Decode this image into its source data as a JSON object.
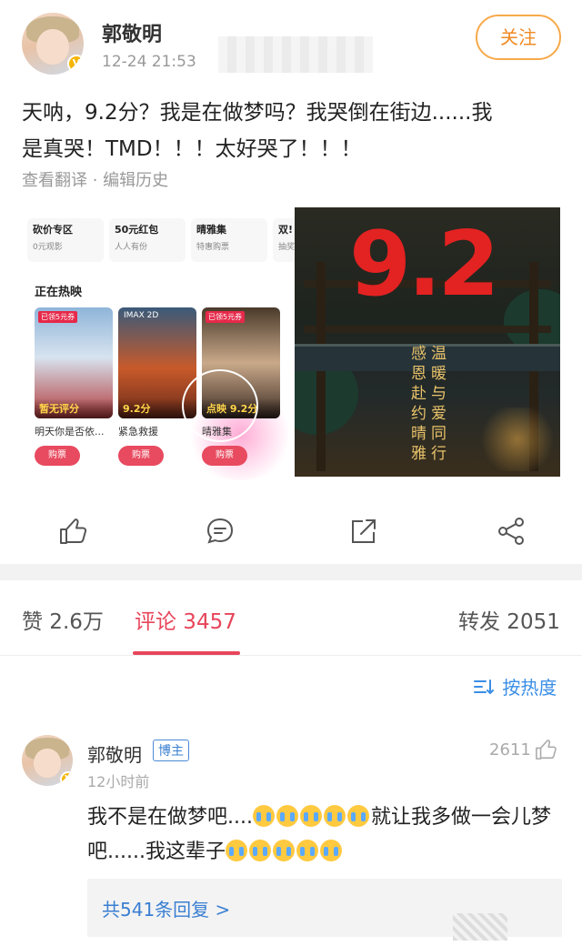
{
  "post": {
    "author": "郭敬明",
    "time": "12-24 21:53",
    "follow_label": "关注",
    "text_line1": "天呐，9.2分？我是在做梦吗？我哭倒在街边......我",
    "text_line2": "是真哭！TMD！！！太好哭了！！！",
    "meta": "查看翻译 · 编辑历史"
  },
  "embedded": {
    "promos": [
      {
        "title": "砍价专区",
        "sub": "0元观影"
      },
      {
        "title": "50元红包",
        "sub": "人人有份"
      },
      {
        "title": "晴雅集",
        "sub": "特惠购票"
      },
      {
        "title": "双!",
        "sub": "抽奖"
      }
    ],
    "section": "正在热映",
    "movies": [
      {
        "tag": "已领5元券",
        "label": "暂无评分",
        "name": "明天你是否依...",
        "buy": "购票"
      },
      {
        "tag": "IMAX 2D",
        "label": "9.2分",
        "name": "紧急救援",
        "buy": "购票"
      },
      {
        "tag": "已领5元券",
        "label": "点映 9.2分",
        "name": "晴雅集",
        "buy": "购票"
      }
    ]
  },
  "poster": {
    "score": "9.2",
    "col1": "感恩赴约晴雅",
    "col2": "温暖与爱同行"
  },
  "tabs": {
    "likes": "赞 2.6万",
    "comments": "评论 3457",
    "reposts": "转发 2051"
  },
  "sort_label": "按热度",
  "comment": {
    "author": "郭敬明",
    "badge": "博主",
    "time": "12小时前",
    "likes": "2611",
    "text_a": "我不是在做梦吧....",
    "text_b": "就让我多做一会儿梦吧......我这辈子",
    "replies": "共541条回复 >"
  },
  "colors": {
    "accent": "#e8455a",
    "link": "#3a7fd2",
    "follow": "#f08a24"
  }
}
